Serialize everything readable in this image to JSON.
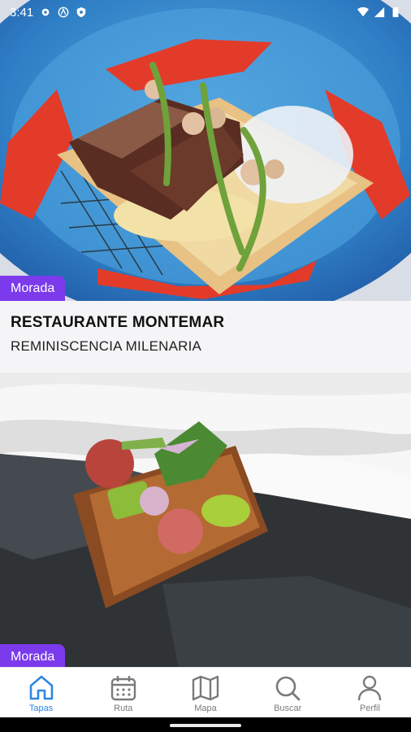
{
  "status_bar": {
    "time": "3:41",
    "icons_left": [
      "gear-icon",
      "accessibility-icon",
      "shield-icon"
    ],
    "icons_right": [
      "wifi-icon",
      "signal-icon",
      "battery-icon"
    ]
  },
  "feed": {
    "cards": [
      {
        "tag": "Morada",
        "title": "RESTAURANTE MONTEMAR",
        "subtitle": "REMINISCENCIA MILENARIA",
        "image": "plated-tapa-on-patterned-bowl"
      },
      {
        "tag": "Morada",
        "title": "",
        "subtitle": "",
        "image": "tartare-on-slate"
      }
    ]
  },
  "bottom_nav": {
    "items": [
      {
        "label": "Tapas",
        "icon": "home-icon",
        "active": true
      },
      {
        "label": "Ruta",
        "icon": "calendar-icon",
        "active": false
      },
      {
        "label": "Mapa",
        "icon": "map-icon",
        "active": false
      },
      {
        "label": "Buscar",
        "icon": "search-icon",
        "active": false
      },
      {
        "label": "Perfil",
        "icon": "user-icon",
        "active": false
      }
    ]
  },
  "colors": {
    "accent": "#2f86e0",
    "tag": "#7c3aed"
  }
}
